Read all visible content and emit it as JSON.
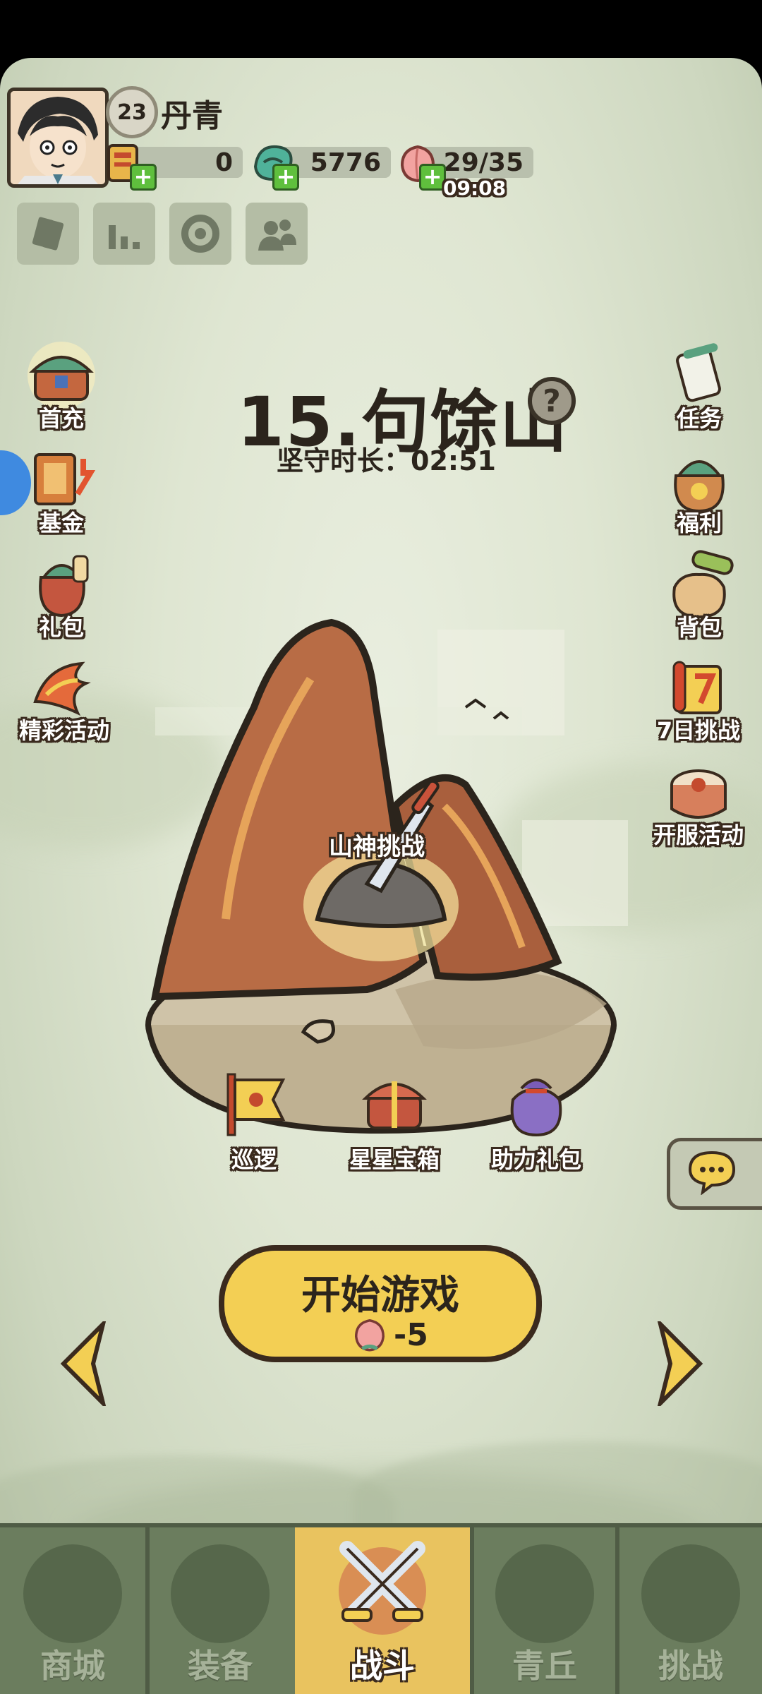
{
  "player": {
    "level": "23",
    "name": "丹青"
  },
  "resources": {
    "coupons": "0",
    "jade": "5776",
    "stamina": "29/35",
    "stamina_timer": "09:08"
  },
  "stage": {
    "title": "15.句馀山",
    "hold_label": "坚守时长：",
    "hold_time": "02:51",
    "challenge": "山神挑战"
  },
  "left_menu": [
    "首充",
    "基金",
    "礼包",
    "精彩活动"
  ],
  "right_menu": [
    "任务",
    "福利",
    "背包",
    "7日挑战",
    "开服活动"
  ],
  "stage_actions": [
    "巡逻",
    "星星宝箱",
    "助力礼包"
  ],
  "start": {
    "label": "开始游戏",
    "cost": "-5"
  },
  "tabs": [
    "商城",
    "装备",
    "战斗",
    "青丘",
    "挑战"
  ],
  "active_tab": "战斗",
  "colors": {
    "accent_yellow": "#f3cf54",
    "ink": "#2b241c",
    "tab_bar": "#6b7d5e",
    "mountain": "#b56a44"
  }
}
